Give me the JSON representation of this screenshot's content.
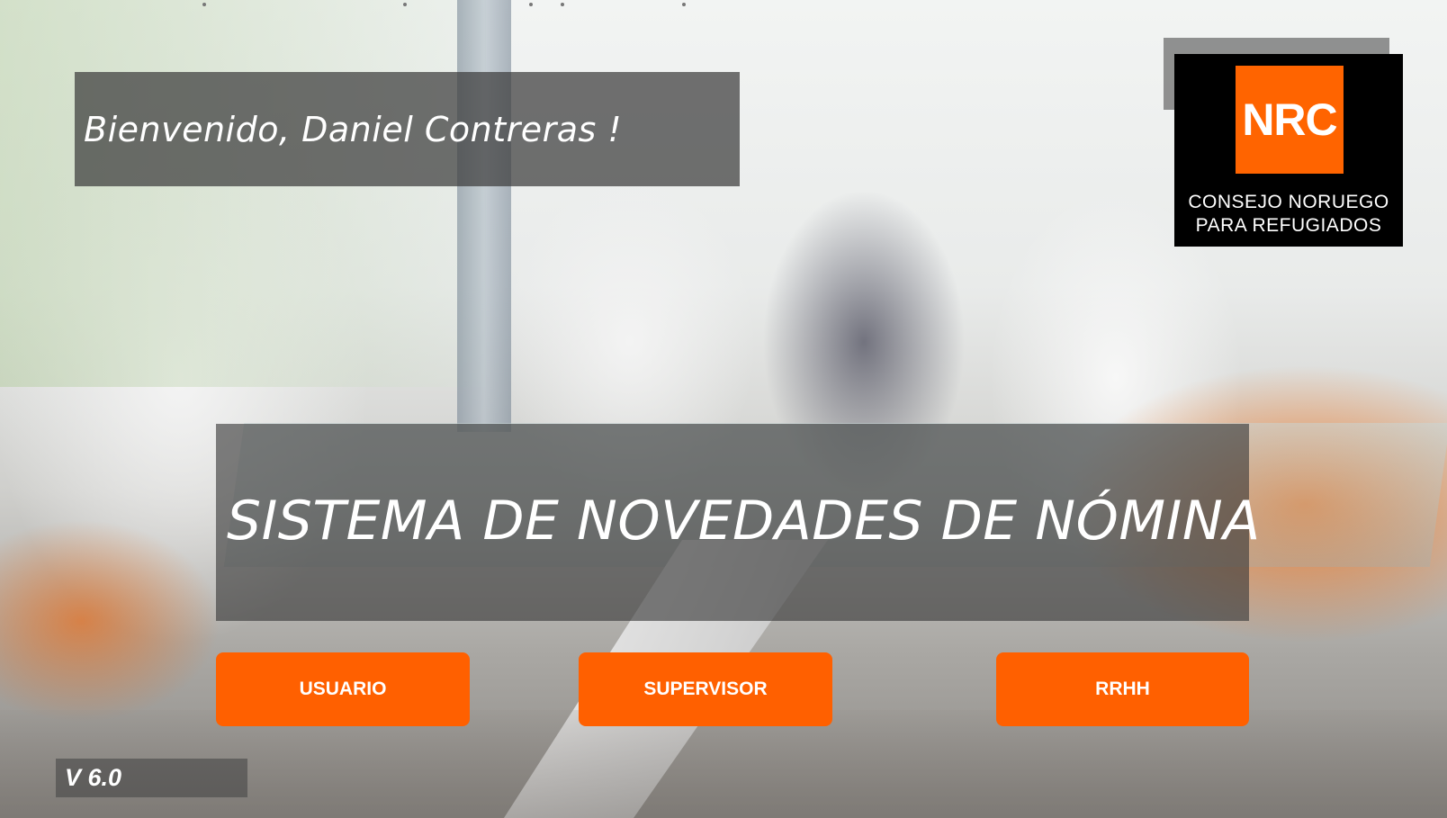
{
  "welcome": {
    "text": "Bienvenido, Daniel Contreras !"
  },
  "logo": {
    "mark": "NRC",
    "line1": "CONSEJO NORUEGO",
    "line2": "PARA REFUGIADOS",
    "color": "#ff6400"
  },
  "main": {
    "title": "SISTEMA DE NOVEDADES DE NÓMINA"
  },
  "buttons": {
    "usuario": "USUARIO",
    "supervisor": "SUPERVISOR",
    "rrhh": "RRHH",
    "color": "#ff6000"
  },
  "footer": {
    "version": "V 6.0"
  },
  "background": {
    "icon": "office-meeting-photo"
  }
}
